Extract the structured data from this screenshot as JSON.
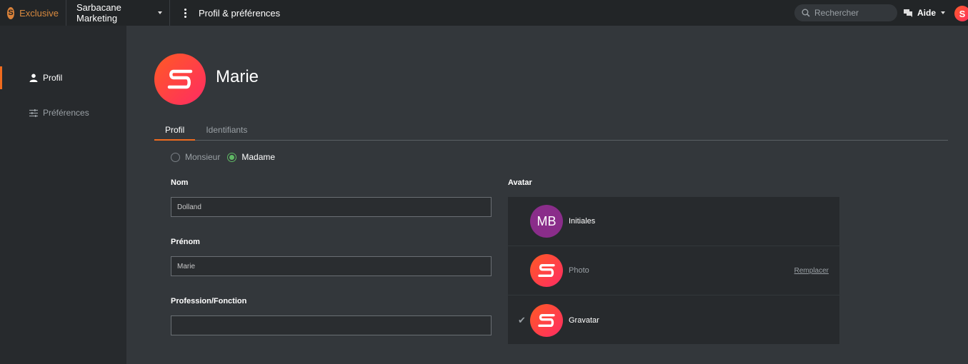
{
  "topbar": {
    "brand_name": "Exclusive",
    "brand_logo": "S",
    "workspace": "Sarbacane Marketing",
    "page_title": "Profil & préférences",
    "search_placeholder": "Rechercher",
    "help_label": "Aide",
    "user_avatar": "S"
  },
  "sidebar": {
    "items": [
      {
        "label": "Profil",
        "icon": "user-icon",
        "active": true
      },
      {
        "label": "Préférences",
        "icon": "sliders-icon",
        "active": false
      }
    ]
  },
  "profile": {
    "name": "Marie",
    "tabs": [
      {
        "label": "Profil",
        "active": true
      },
      {
        "label": "Identifiants",
        "active": false
      }
    ],
    "civility": {
      "options": [
        "Monsieur",
        "Madame"
      ],
      "selected": "Madame"
    },
    "fields": {
      "nom_label": "Nom",
      "nom_value": "Dolland",
      "prenom_label": "Prénom",
      "prenom_value": "Marie",
      "profession_label": "Profession/Fonction",
      "profession_value": ""
    },
    "avatar": {
      "label": "Avatar",
      "options": [
        {
          "kind": "initials",
          "badge": "MB",
          "label": "Initiales",
          "selected": false
        },
        {
          "kind": "photo",
          "label": "Photo",
          "action": "Remplacer",
          "selected": false
        },
        {
          "kind": "gravatar",
          "label": "Gravatar",
          "selected": true
        }
      ]
    }
  },
  "colors": {
    "accent": "#f06b1e",
    "brand_gradient_start": "#ff5a24",
    "brand_gradient_end": "#ff2b63",
    "initials_bg": "#8a2d8a",
    "radio_selected": "#5fb864"
  }
}
